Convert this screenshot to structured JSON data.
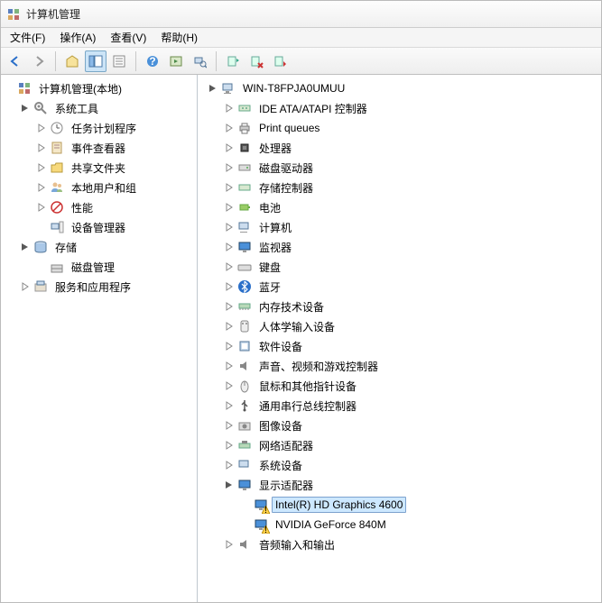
{
  "window": {
    "title": "计算机管理"
  },
  "menu": {
    "file": "文件(F)",
    "action": "操作(A)",
    "view": "查看(V)",
    "help": "帮助(H)"
  },
  "toolbar": {
    "back": "back",
    "forward": "forward",
    "up": "up",
    "show_tree": "show-console-tree",
    "properties": "properties",
    "help": "help",
    "refresh": "refresh",
    "scan": "scan-hardware",
    "update": "update-driver",
    "uninstall": "uninstall",
    "disable": "disable"
  },
  "left_tree": {
    "root": "计算机管理(本地)",
    "system_tools": {
      "label": "系统工具",
      "task_scheduler": "任务计划程序",
      "event_viewer": "事件查看器",
      "shared_folders": "共享文件夹",
      "local_users": "本地用户和组",
      "performance": "性能",
      "device_manager": "设备管理器"
    },
    "storage": {
      "label": "存储",
      "disk_mgmt": "磁盘管理"
    },
    "services": "服务和应用程序"
  },
  "right_tree": {
    "computer": "WIN-T8FPJA0UMUU",
    "ide": "IDE ATA/ATAPI 控制器",
    "print": "Print queues",
    "cpu": "处理器",
    "disk": "磁盘驱动器",
    "storage_ctrl": "存储控制器",
    "battery": "电池",
    "computer_cat": "计算机",
    "monitor": "监视器",
    "keyboard": "键盘",
    "bluetooth": "蓝牙",
    "memory": "内存技术设备",
    "hid": "人体学输入设备",
    "software": "软件设备",
    "sound": "声音、视频和游戏控制器",
    "mouse": "鼠标和其他指针设备",
    "usb": "通用串行总线控制器",
    "imaging": "图像设备",
    "network": "网络适配器",
    "system_dev": "系统设备",
    "display": {
      "label": "显示适配器",
      "intel": "Intel(R) HD Graphics 4600",
      "nvidia": "NVIDIA GeForce 840M"
    },
    "audio_io": "音频输入和输出"
  }
}
